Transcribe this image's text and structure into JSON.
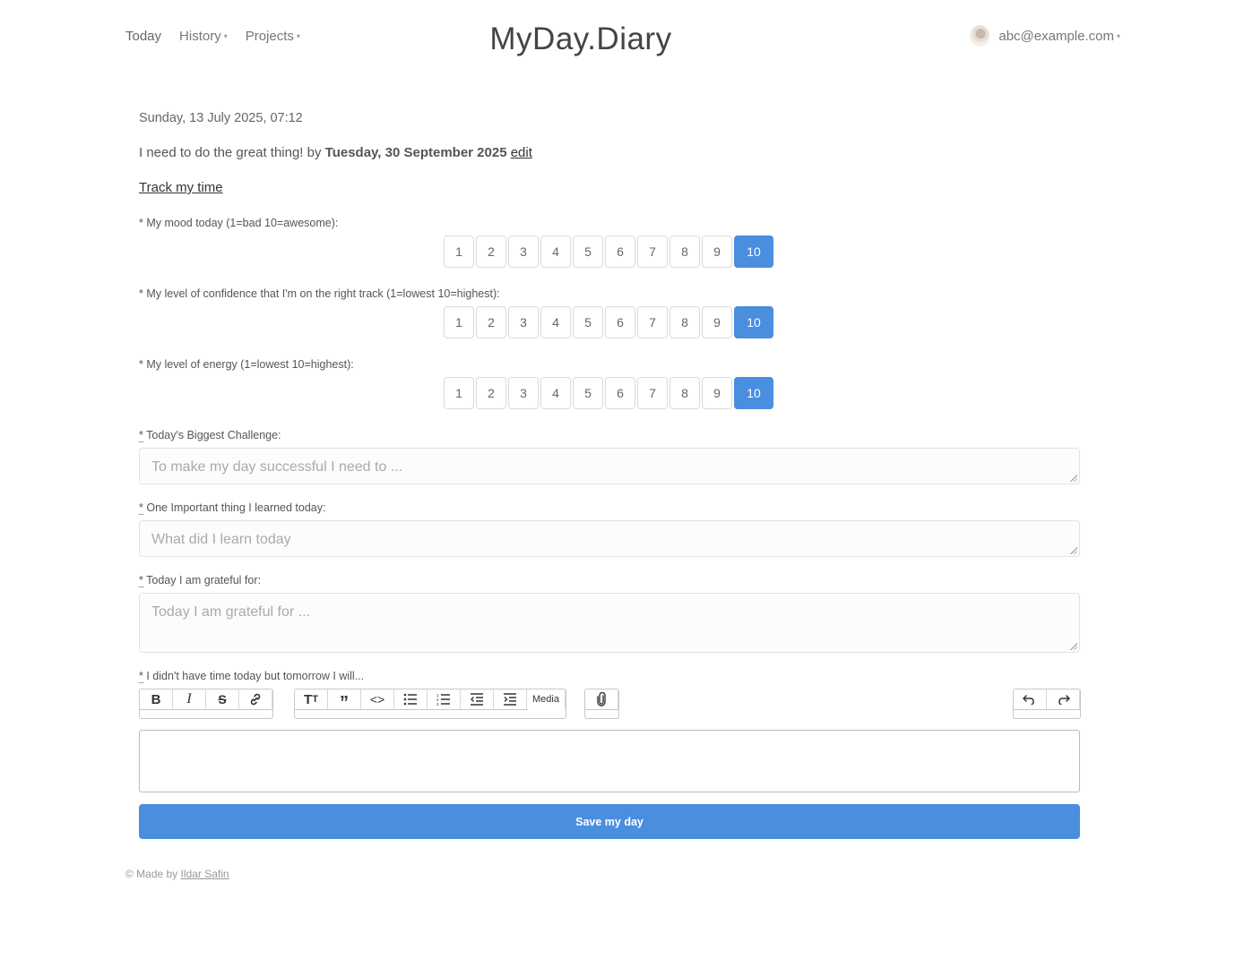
{
  "nav": {
    "today": "Today",
    "history": "History",
    "projects": "Projects",
    "brand": "MyDay.Diary",
    "user_email": "abc@example.com"
  },
  "entry": {
    "date": "Sunday, 13 July 2025, 07:12",
    "goal_prefix": "I need to do the great thing! by ",
    "goal_date": "Tuesday, 30 September 2025",
    "goal_edit": "edit",
    "track_time": "Track my time"
  },
  "ratings": [
    {
      "label": "* My mood today (1=bad 10=awesome):",
      "selected": 10
    },
    {
      "label": "* My level of confidence that I'm on the right track (1=lowest 10=highest):",
      "selected": 10
    },
    {
      "label": "* My level of energy (1=lowest 10=highest):",
      "selected": 10
    }
  ],
  "rating_values": [
    "1",
    "2",
    "3",
    "4",
    "5",
    "6",
    "7",
    "8",
    "9",
    "10"
  ],
  "fields": {
    "challenge_label": "Today's Biggest Challenge:",
    "challenge_placeholder": "To make my day successful I need to ...",
    "learned_label": "One Important thing I learned today:",
    "learned_placeholder": "What did I learn today",
    "grateful_label": "Today I am grateful for:",
    "grateful_placeholder": "Today I am grateful for ...",
    "tomorrow_label": "I didn't have time today but tomorrow I will...",
    "required_mark": "*"
  },
  "toolbar": {
    "media_label": "Media",
    "icons": [
      "bold-icon",
      "italic-icon",
      "strikethrough-icon",
      "link-icon",
      "heading-icon",
      "quote-icon",
      "code-icon",
      "bullet-list-icon",
      "numbered-list-icon",
      "outdent-icon",
      "indent-icon",
      "attach-icon",
      "undo-icon",
      "redo-icon"
    ]
  },
  "save_label": "Save my day",
  "footer": {
    "prefix": "© Made by ",
    "author": "Ildar Safin"
  },
  "colors": {
    "accent": "#4a8fdf"
  }
}
